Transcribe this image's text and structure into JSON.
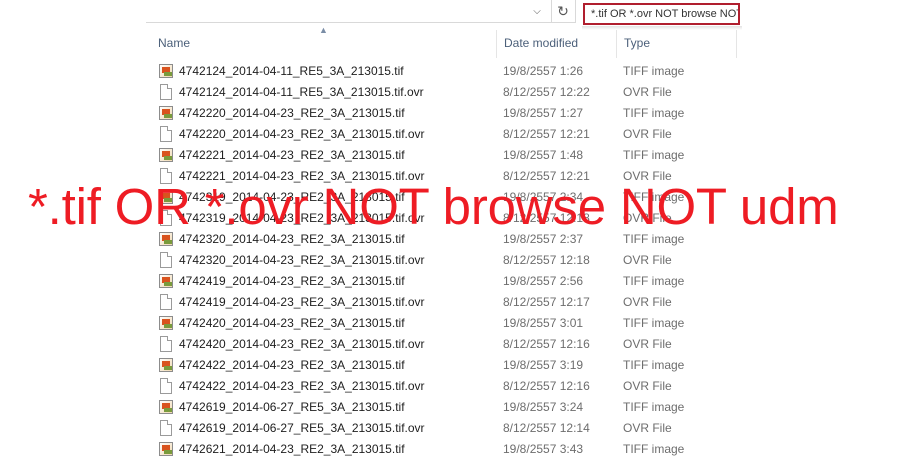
{
  "search": {
    "query": "*.tif OR *.ovr NOT browse NOT udm"
  },
  "toolbar": {
    "dropdown_icon": "chevron-down-icon",
    "refresh_icon": "refresh-icon"
  },
  "columns": {
    "name": "Name",
    "date_modified": "Date modified",
    "type": "Type"
  },
  "files": [
    {
      "name": "4742124_2014-04-11_RE5_3A_213015.tif",
      "date": "19/8/2557 1:26",
      "type": "TIFF image",
      "icon": "tiff-image-icon"
    },
    {
      "name": "4742124_2014-04-11_RE5_3A_213015.tif.ovr",
      "date": "8/12/2557 12:22",
      "type": "OVR File",
      "icon": "ovr-file-icon"
    },
    {
      "name": "4742220_2014-04-23_RE2_3A_213015.tif",
      "date": "19/8/2557 1:27",
      "type": "TIFF image",
      "icon": "tiff-image-icon"
    },
    {
      "name": "4742220_2014-04-23_RE2_3A_213015.tif.ovr",
      "date": "8/12/2557 12:21",
      "type": "OVR File",
      "icon": "ovr-file-icon"
    },
    {
      "name": "4742221_2014-04-23_RE2_3A_213015.tif",
      "date": "19/8/2557 1:48",
      "type": "TIFF image",
      "icon": "tiff-image-icon"
    },
    {
      "name": "4742221_2014-04-23_RE2_3A_213015.tif.ovr",
      "date": "8/12/2557 12:21",
      "type": "OVR File",
      "icon": "ovr-file-icon"
    },
    {
      "name": "4742319_2014-04-23_RE2_3A_213015.tif",
      "date": "19/8/2557 2:34",
      "type": "TIFF image",
      "icon": "tiff-image-icon"
    },
    {
      "name": "4742319_2014-04-23_RE2_3A_213015.tif.ovr",
      "date": "8/12/2557 12:18",
      "type": "OVR File",
      "icon": "ovr-file-icon"
    },
    {
      "name": "4742320_2014-04-23_RE2_3A_213015.tif",
      "date": "19/8/2557 2:37",
      "type": "TIFF image",
      "icon": "tiff-image-icon"
    },
    {
      "name": "4742320_2014-04-23_RE2_3A_213015.tif.ovr",
      "date": "8/12/2557 12:18",
      "type": "OVR File",
      "icon": "ovr-file-icon"
    },
    {
      "name": "4742419_2014-04-23_RE2_3A_213015.tif",
      "date": "19/8/2557 2:56",
      "type": "TIFF image",
      "icon": "tiff-image-icon"
    },
    {
      "name": "4742419_2014-04-23_RE2_3A_213015.tif.ovr",
      "date": "8/12/2557 12:17",
      "type": "OVR File",
      "icon": "ovr-file-icon"
    },
    {
      "name": "4742420_2014-04-23_RE2_3A_213015.tif",
      "date": "19/8/2557 3:01",
      "type": "TIFF image",
      "icon": "tiff-image-icon"
    },
    {
      "name": "4742420_2014-04-23_RE2_3A_213015.tif.ovr",
      "date": "8/12/2557 12:16",
      "type": "OVR File",
      "icon": "ovr-file-icon"
    },
    {
      "name": "4742422_2014-04-23_RE2_3A_213015.tif",
      "date": "19/8/2557 3:19",
      "type": "TIFF image",
      "icon": "tiff-image-icon"
    },
    {
      "name": "4742422_2014-04-23_RE2_3A_213015.tif.ovr",
      "date": "8/12/2557 12:16",
      "type": "OVR File",
      "icon": "ovr-file-icon"
    },
    {
      "name": "4742619_2014-06-27_RE5_3A_213015.tif",
      "date": "19/8/2557 3:24",
      "type": "TIFF image",
      "icon": "tiff-image-icon"
    },
    {
      "name": "4742619_2014-06-27_RE5_3A_213015.tif.ovr",
      "date": "8/12/2557 12:14",
      "type": "OVR File",
      "icon": "ovr-file-icon"
    },
    {
      "name": "4742621_2014-04-23_RE2_3A_213015.tif",
      "date": "19/8/2557 3:43",
      "type": "TIFF image",
      "icon": "tiff-image-icon"
    }
  ],
  "overlay": {
    "text": "*.tif OR *.ovr NOT browse NOT udm",
    "color": "#ee1c24"
  },
  "colors": {
    "search_border": "#b01e2e",
    "header_text": "#4c607a"
  }
}
